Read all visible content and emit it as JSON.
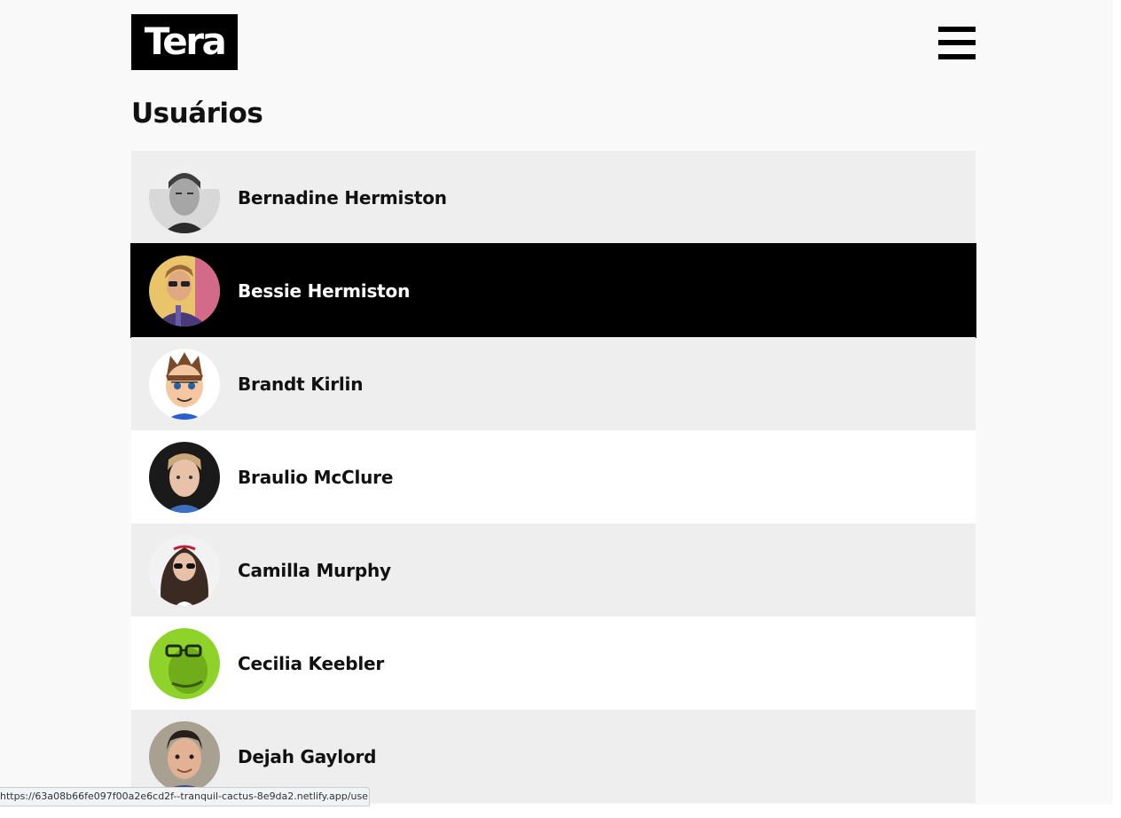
{
  "header": {
    "logo_text": "Tera",
    "menu_icon": "hamburger-menu-icon"
  },
  "main": {
    "title": "Usuários"
  },
  "users": [
    {
      "name": "Bernadine Hermiston",
      "selected": false
    },
    {
      "name": "Bessie Hermiston",
      "selected": true
    },
    {
      "name": "Brandt Kirlin",
      "selected": false
    },
    {
      "name": "Braulio McClure",
      "selected": false
    },
    {
      "name": "Camilla Murphy",
      "selected": false
    },
    {
      "name": "Cecilia Keebler",
      "selected": false
    },
    {
      "name": "Dejah Gaylord",
      "selected": false
    }
  ],
  "status_bar": {
    "url": "https://63a08b66fe097f00a2e6cd2f--tranquil-cactus-8e9da2.netlify.app/user..."
  },
  "colors": {
    "background": "#f9f9f9",
    "row_light": "#eeeeee",
    "row_white": "#ffffff",
    "selected_row": "#000000",
    "logo_bg": "#000000"
  }
}
